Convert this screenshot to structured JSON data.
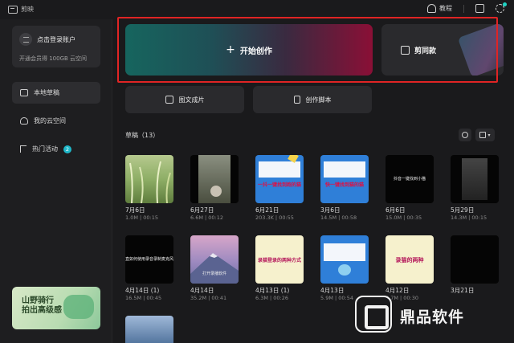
{
  "app": {
    "name": "剪映"
  },
  "topbar": {
    "tutorial_label": "教程"
  },
  "sidebar": {
    "login_title": "点击登录账户",
    "login_sub": "开通会员得 100GB 云空间",
    "items": [
      {
        "label": "本地草稿",
        "icon": "folder-icon"
      },
      {
        "label": "我的云空间",
        "icon": "cloud-icon"
      },
      {
        "label": "热门活动",
        "icon": "flag-icon",
        "badge": "2"
      }
    ],
    "promo": {
      "line1": "山野骑行",
      "line2": "拍出高级感"
    }
  },
  "main": {
    "create_label": "开始创作",
    "template_label": "剪同款",
    "image_to_video_label": "图文成片",
    "script_label": "创作脚本",
    "drafts_title": "草稿（13）"
  },
  "drafts": [
    {
      "date": "7月6日",
      "info": "1.0M | 00:15"
    },
    {
      "date": "6月27日",
      "info": "6.6M | 00:12"
    },
    {
      "date": "6月21日",
      "info": "203.3K | 00:55"
    },
    {
      "date": "3月6日",
      "info": "14.5M | 00:58"
    },
    {
      "date": "6月6日",
      "info": "15.0M | 00:35"
    },
    {
      "date": "5月29日",
      "info": "14.3M | 00:15"
    },
    {
      "date": "4月14日 (1)",
      "info": "16.5M | 00:45"
    },
    {
      "date": "4月14日",
      "info": "35.2M | 00:41"
    },
    {
      "date": "4月13日 (1)",
      "info": "6.3M | 00:26"
    },
    {
      "date": "4月13日",
      "info": "5.9M | 00:54"
    },
    {
      "date": "4月12日",
      "info": "3.7M | 00:30"
    },
    {
      "date": "3月21日",
      "info": ""
    }
  ],
  "thumb_texts": {
    "t3": "一抖一键找到跑的猫",
    "t4": "快一键找到猫的猫",
    "t5": "抖音一键找到小猫",
    "t7": "直如何使用录音录制麦克风",
    "t8": "打开录播软件",
    "t9": "录猫登录的两种方式",
    "t11": "录猫的两种"
  },
  "watermark": {
    "text": "鼎品软件"
  },
  "colors": {
    "accent": "#1fb8c9",
    "highlight": "#e02424"
  }
}
